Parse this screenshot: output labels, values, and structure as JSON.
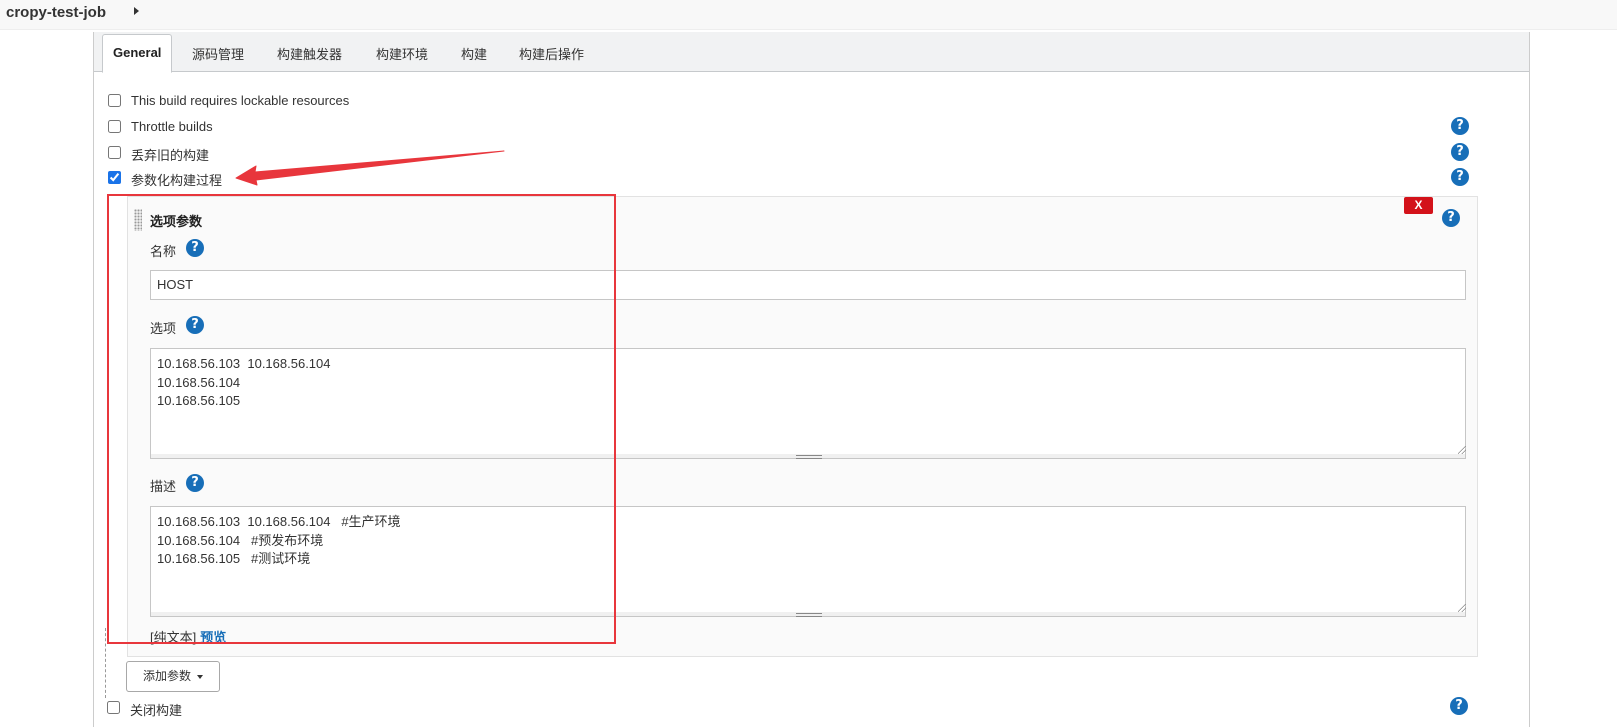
{
  "breadcrumb": {
    "job_name": "cropy-test-job"
  },
  "tabs": [
    {
      "label": "General",
      "active": true
    },
    {
      "label": "源码管理"
    },
    {
      "label": "构建触发器"
    },
    {
      "label": "构建环境"
    },
    {
      "label": "构建"
    },
    {
      "label": "构建后操作"
    }
  ],
  "options": [
    {
      "label": "This build requires lockable resources",
      "checked": false
    },
    {
      "label": "Throttle builds",
      "checked": false
    },
    {
      "label": "丢弃旧的构建",
      "checked": false
    },
    {
      "label": "参数化构建过程",
      "checked": true
    },
    {
      "label": "关闭构建",
      "checked": false
    }
  ],
  "help_glyph": "?",
  "parameter": {
    "type_title": "选项参数",
    "delete_label": "X",
    "name_label": "名称",
    "name_value": "HOST",
    "choices_label": "选项",
    "choices_value": "10.168.56.103  10.168.56.104\n10.168.56.104\n10.168.56.105",
    "description_label": "描述",
    "description_value": "10.168.56.103  10.168.56.104   #生产环境\n10.168.56.104   #预发布环境\n10.168.56.105   #测试环境",
    "format_text": "[纯文本]",
    "preview_label": "预览"
  },
  "add_parameter_label": "添加参数",
  "colors": {
    "help_icon": "#176eb8",
    "delete_button": "#d3121a",
    "annotation": "#e8363c"
  }
}
